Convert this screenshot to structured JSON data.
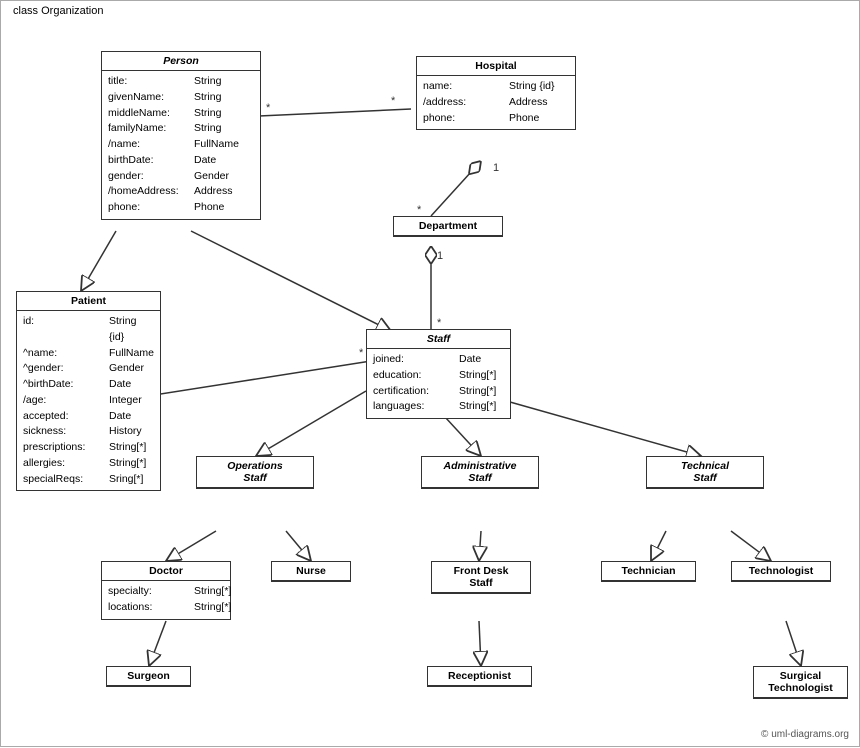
{
  "diagram": {
    "title": "class Organization",
    "footer": "© uml-diagrams.org",
    "classes": {
      "person": {
        "name": "Person",
        "italic": true,
        "attrs": [
          {
            "name": "title:",
            "type": "String"
          },
          {
            "name": "givenName:",
            "type": "String"
          },
          {
            "name": "middleName:",
            "type": "String"
          },
          {
            "name": "familyName:",
            "type": "String"
          },
          {
            "name": "/name:",
            "type": "FullName"
          },
          {
            "name": "birthDate:",
            "type": "Date"
          },
          {
            "name": "gender:",
            "type": "Gender"
          },
          {
            "name": "/homeAddress:",
            "type": "Address"
          },
          {
            "name": "phone:",
            "type": "Phone"
          }
        ]
      },
      "hospital": {
        "name": "Hospital",
        "italic": false,
        "attrs": [
          {
            "name": "name:",
            "type": "String {id}"
          },
          {
            "name": "/address:",
            "type": "Address"
          },
          {
            "name": "phone:",
            "type": "Phone"
          }
        ]
      },
      "patient": {
        "name": "Patient",
        "italic": false,
        "attrs": [
          {
            "name": "id:",
            "type": "String {id}"
          },
          {
            "name": "^name:",
            "type": "FullName"
          },
          {
            "name": "^gender:",
            "type": "Gender"
          },
          {
            "name": "^birthDate:",
            "type": "Date"
          },
          {
            "name": "/age:",
            "type": "Integer"
          },
          {
            "name": "accepted:",
            "type": "Date"
          },
          {
            "name": "sickness:",
            "type": "History"
          },
          {
            "name": "prescriptions:",
            "type": "String[*]"
          },
          {
            "name": "allergies:",
            "type": "String[*]"
          },
          {
            "name": "specialReqs:",
            "type": "Sring[*]"
          }
        ]
      },
      "department": {
        "name": "Department",
        "italic": false,
        "attrs": []
      },
      "staff": {
        "name": "Staff",
        "italic": true,
        "attrs": [
          {
            "name": "joined:",
            "type": "Date"
          },
          {
            "name": "education:",
            "type": "String[*]"
          },
          {
            "name": "certification:",
            "type": "String[*]"
          },
          {
            "name": "languages:",
            "type": "String[*]"
          }
        ]
      },
      "operations_staff": {
        "name": "Operations\nStaff",
        "italic": true,
        "attrs": []
      },
      "administrative_staff": {
        "name": "Administrative\nStaff",
        "italic": true,
        "attrs": []
      },
      "technical_staff": {
        "name": "Technical\nStaff",
        "italic": true,
        "attrs": []
      },
      "doctor": {
        "name": "Doctor",
        "italic": false,
        "attrs": [
          {
            "name": "specialty:",
            "type": "String[*]"
          },
          {
            "name": "locations:",
            "type": "String[*]"
          }
        ]
      },
      "nurse": {
        "name": "Nurse",
        "italic": false,
        "attrs": []
      },
      "front_desk_staff": {
        "name": "Front Desk\nStaff",
        "italic": false,
        "attrs": []
      },
      "technician": {
        "name": "Technician",
        "italic": false,
        "attrs": []
      },
      "technologist": {
        "name": "Technologist",
        "italic": false,
        "attrs": []
      },
      "surgeon": {
        "name": "Surgeon",
        "italic": false,
        "attrs": []
      },
      "receptionist": {
        "name": "Receptionist",
        "italic": false,
        "attrs": []
      },
      "surgical_technologist": {
        "name": "Surgical\nTechnologist",
        "italic": false,
        "attrs": []
      }
    }
  }
}
